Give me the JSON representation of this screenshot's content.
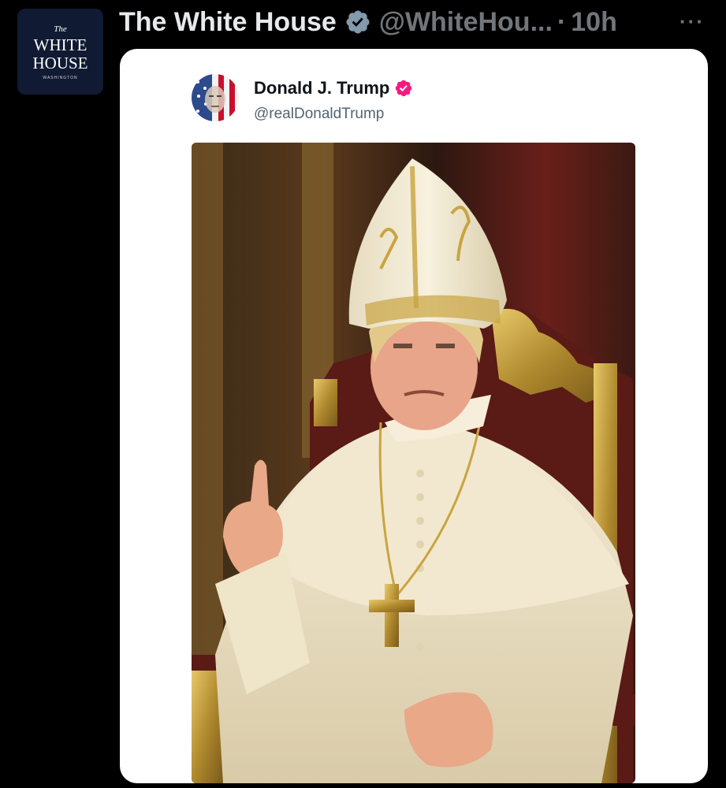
{
  "author": {
    "avatar": {
      "the": "The",
      "line1": "WHITE",
      "line2": "HOUSE",
      "line3": "WASHINGTON",
      "bg_color": "#111a33"
    },
    "display_name": "The White House",
    "verified_color": "#829aab",
    "handle": "@WhiteHou...",
    "separator": "·",
    "time": "10h",
    "more_label": "···"
  },
  "embedded_post": {
    "display_name": "Donald J. Trump",
    "verified_color": "#f91880",
    "handle": "@realDonaldTrump",
    "image": {
      "icon": "generated-portrait-image"
    }
  },
  "colors": {
    "background": "#000000",
    "card": "#ffffff",
    "primary_text": "#e7e9ea",
    "secondary_text": "#71767b"
  }
}
